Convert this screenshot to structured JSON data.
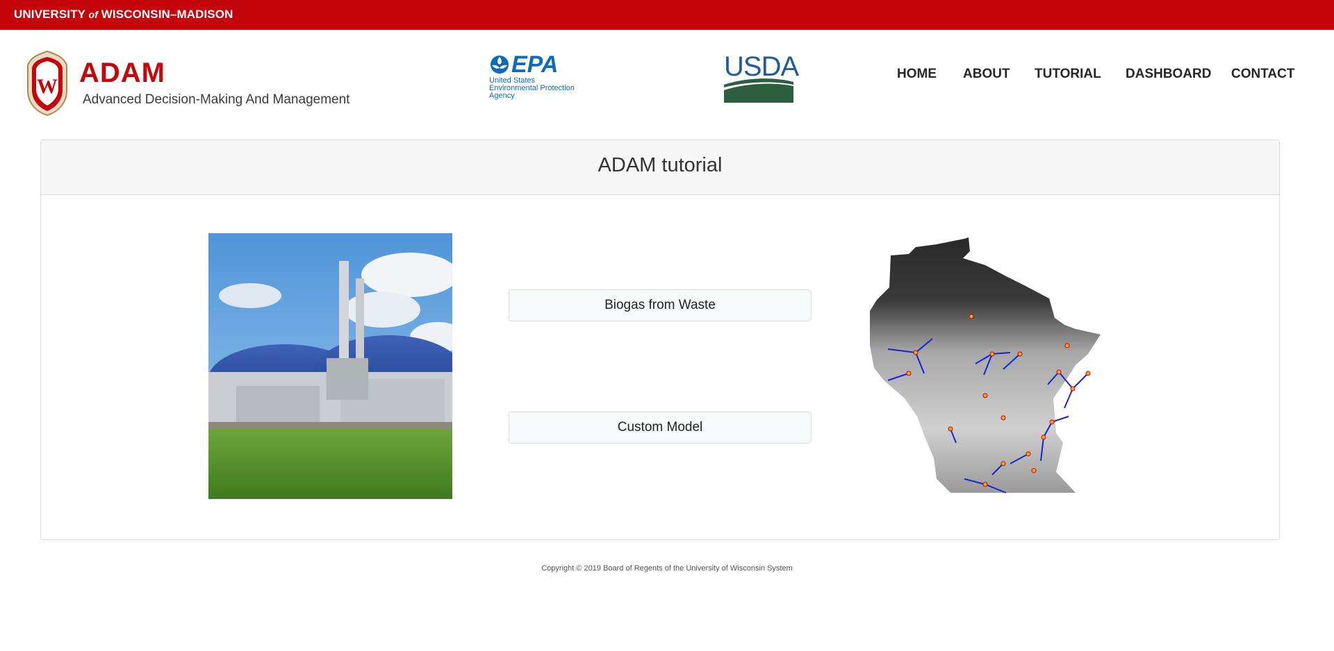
{
  "topbar": {
    "university_pre": "UNIVERSITY ",
    "university_of": "of",
    "university_post": " WISCONSIN–MADISON"
  },
  "brand": {
    "title": "ADAM",
    "subtitle": "Advanced Decision-Making And Management",
    "logo": "uw-crest-icon"
  },
  "partners": {
    "epa_mark": "EPA",
    "epa_lines": [
      "United States",
      "Environmental Protection",
      "Agency"
    ],
    "usda_mark": "USDA"
  },
  "nav": {
    "items": [
      "HOME",
      "ABOUT",
      "TUTORIAL",
      "DASHBOARD",
      "CONTACT"
    ]
  },
  "card": {
    "title": "ADAM tutorial",
    "buttons": {
      "biogas": "Biogas from Waste",
      "custom": "Custom Model"
    }
  },
  "footer": {
    "copyright": "Copyright © 2019 Board of Regents of the University of Wisconsin System"
  },
  "colors": {
    "brand_red": "#c5050c",
    "epa_blue": "#0e6cb5",
    "usda_blue": "#1f5c99",
    "usda_green": "#2c5e3f"
  }
}
